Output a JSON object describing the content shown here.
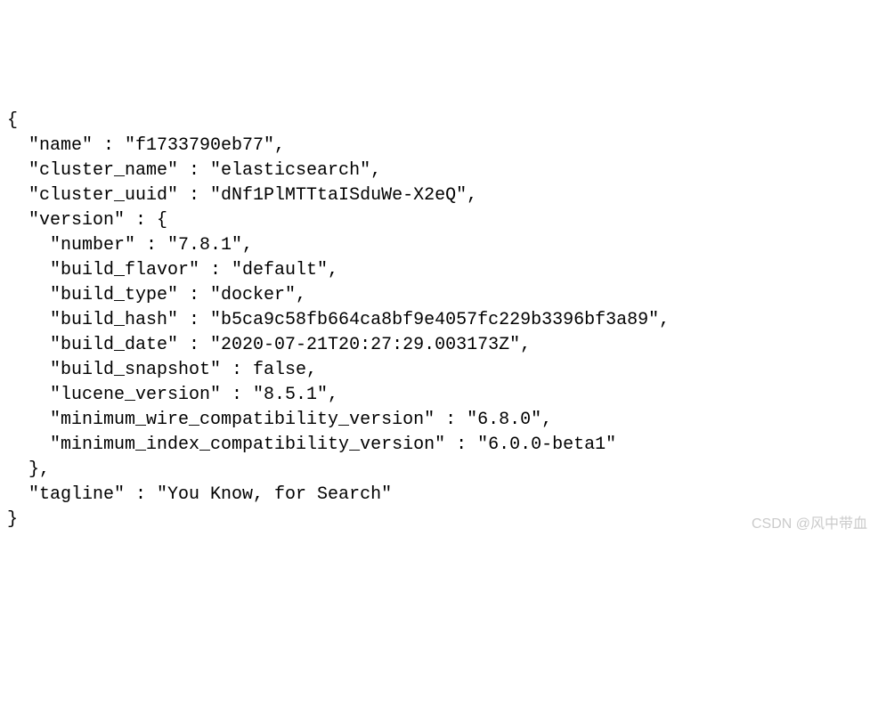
{
  "json": {
    "open_brace": "{",
    "name_line": "  \"name\" : \"f1733790eb77\",",
    "cluster_name_line": "  \"cluster_name\" : \"elasticsearch\",",
    "cluster_uuid_line": "  \"cluster_uuid\" : \"dNf1PlMTTtaISduWe-X2eQ\",",
    "version_open": "  \"version\" : {",
    "number_line": "    \"number\" : \"7.8.1\",",
    "build_flavor_line": "    \"build_flavor\" : \"default\",",
    "build_type_line": "    \"build_type\" : \"docker\",",
    "build_hash_line": "    \"build_hash\" : \"b5ca9c58fb664ca8bf9e4057fc229b3396bf3a89\",",
    "build_date_line": "    \"build_date\" : \"2020-07-21T20:27:29.003173Z\",",
    "build_snapshot_line": "    \"build_snapshot\" : false,",
    "lucene_version_line": "    \"lucene_version\" : \"8.5.1\",",
    "min_wire_line": "    \"minimum_wire_compatibility_version\" : \"6.8.0\",",
    "min_index_line": "    \"minimum_index_compatibility_version\" : \"6.0.0-beta1\"",
    "version_close": "  },",
    "tagline_line": "  \"tagline\" : \"You Know, for Search\"",
    "close_brace": "}"
  },
  "watermark": "CSDN @风中带血"
}
